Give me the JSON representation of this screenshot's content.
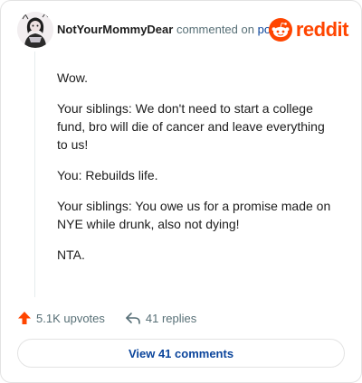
{
  "header": {
    "username": "NotYourMommyDear",
    "action_text": "commented on",
    "post_link": "post",
    "logo_text": "reddit",
    "logo_icon": "reddit-snoo-icon",
    "brand_color": "#ff4500"
  },
  "comment": {
    "paragraphs": [
      "Wow.",
      "Your siblings: We don't need to start a college fund, bro will die of cancer and leave everything to us!",
      "You: Rebuilds life.",
      "Your siblings: You owe us for a promise made on NYE while drunk, also not dying!",
      "NTA."
    ]
  },
  "actions": {
    "upvotes_label": "5.1K upvotes",
    "upvote_icon": "upvote-arrow-icon",
    "replies_label": "41 replies",
    "reply_icon": "reply-arrow-icon"
  },
  "footer": {
    "view_comments_label": "View 41 comments"
  },
  "colors": {
    "link": "#0a449b",
    "muted": "#576f76",
    "upvote": "#ff4500"
  }
}
